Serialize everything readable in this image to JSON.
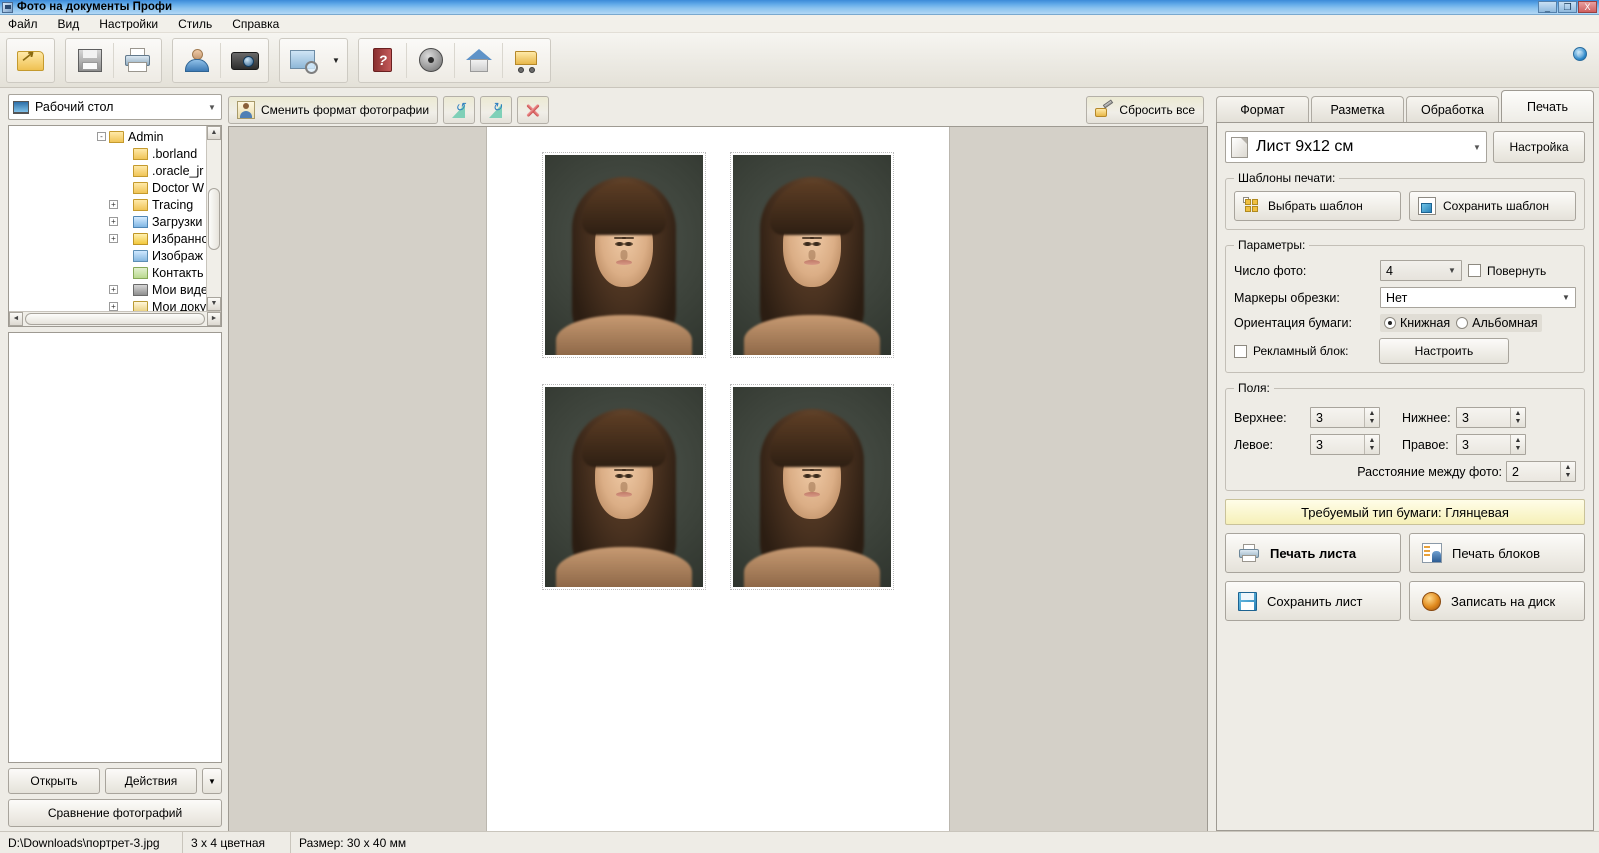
{
  "window": {
    "title": "Фото на документы Профи",
    "icon": "app-icon",
    "buttons": {
      "minimize": "_",
      "maximize": "❐",
      "close": "X"
    }
  },
  "menubar": {
    "items": [
      {
        "label": "Файл"
      },
      {
        "label": "Вид"
      },
      {
        "label": "Настройки"
      },
      {
        "label": "Стиль"
      },
      {
        "label": "Справка"
      }
    ]
  },
  "toolbar": {
    "groups": [
      {
        "buttons": [
          {
            "icon": "open-folder-icon"
          }
        ]
      },
      {
        "buttons": [
          {
            "icon": "save-disk-icon"
          },
          {
            "icon": "printer-icon"
          }
        ]
      },
      {
        "buttons": [
          {
            "icon": "person-photo-icon"
          },
          {
            "icon": "camera-icon"
          }
        ]
      },
      {
        "buttons": [
          {
            "icon": "zoom-preview-icon"
          },
          {
            "icon": "chevron-down-icon"
          }
        ]
      },
      {
        "buttons": [
          {
            "icon": "help-book-icon"
          },
          {
            "icon": "film-reel-icon"
          },
          {
            "icon": "home-icon"
          },
          {
            "icon": "cart-icon"
          }
        ]
      }
    ],
    "help_badge": "info-globe-icon"
  },
  "left_panel": {
    "location_combo": {
      "value": "Рабочий стол",
      "icon": "desktop-monitor-icon",
      "arrow": "▼"
    },
    "tree": [
      {
        "label": "Admin",
        "expander": "-",
        "indent": 0,
        "icon": "folder-icon"
      },
      {
        "label": ".borland",
        "expander": "",
        "indent": 1,
        "icon": "folder-icon"
      },
      {
        "label": ".oracle_jr",
        "expander": "",
        "indent": 1,
        "icon": "folder-icon"
      },
      {
        "label": "Doctor W",
        "expander": "",
        "indent": 1,
        "icon": "folder-icon"
      },
      {
        "label": "Tracing",
        "expander": "+",
        "indent": 1,
        "icon": "folder-icon"
      },
      {
        "label": "Загрузки",
        "expander": "+",
        "indent": 1,
        "icon": "folder-downloads-icon"
      },
      {
        "label": "Избранно",
        "expander": "+",
        "indent": 1,
        "icon": "folder-favorites-icon"
      },
      {
        "label": "Изображ",
        "expander": "",
        "indent": 1,
        "icon": "folder-pictures-icon"
      },
      {
        "label": "Контакть",
        "expander": "",
        "indent": 1,
        "icon": "folder-contacts-icon"
      },
      {
        "label": "Мои виде",
        "expander": "+",
        "indent": 1,
        "icon": "folder-videos-icon"
      },
      {
        "label": "Мои доку",
        "expander": "+",
        "indent": 1,
        "icon": "folder-documents-icon"
      }
    ],
    "scroll": {
      "up": "▲",
      "down": "▼",
      "left": "◄",
      "right": "►"
    },
    "buttons": {
      "open": "Открыть",
      "actions": "Действия",
      "actions_arrow": "▼",
      "compare": "Сравнение фотографий"
    }
  },
  "center": {
    "toolbar": {
      "change_format": {
        "label": "Сменить формат фотографии",
        "icon": "person-card-icon"
      },
      "rotate_left": {
        "icon": "rotate-left-icon"
      },
      "rotate_right": {
        "icon": "rotate-right-icon"
      },
      "delete": {
        "icon": "delete-cross-icon"
      },
      "reset_all": {
        "label": "Сбросить все",
        "icon": "brush-reset-icon"
      }
    },
    "sheet": {
      "photo_count": 4,
      "photo_alt": "portrait-photo"
    }
  },
  "right_panel": {
    "tabs": [
      {
        "label": "Формат",
        "active": false
      },
      {
        "label": "Разметка",
        "active": false
      },
      {
        "label": "Обработка",
        "active": false
      },
      {
        "label": "Печать",
        "active": true
      }
    ],
    "sheet_size": {
      "value": "Лист 9x12 см",
      "icon": "page-icon",
      "arrow": "▼"
    },
    "settings_button": "Настройка",
    "templates": {
      "legend": "Шаблоны печати:",
      "choose": {
        "label": "Выбрать шаблон",
        "icon": "template-grid-icon"
      },
      "save": {
        "label": "Сохранить шаблон",
        "icon": "template-save-icon"
      }
    },
    "parameters": {
      "legend": "Параметры:",
      "photo_count": {
        "label": "Число фото:",
        "value": "4",
        "arrow": "▼"
      },
      "rotate": {
        "label": "Повернуть",
        "checked": false
      },
      "crop_markers": {
        "label": "Маркеры обрезки:",
        "value": "Нет",
        "arrow": "▼"
      },
      "orientation": {
        "label": "Ориентация бумаги:",
        "options": [
          {
            "label": "Книжная",
            "selected": true
          },
          {
            "label": "Альбомная",
            "selected": false
          }
        ]
      },
      "ad_block": {
        "label": "Рекламный блок:",
        "checked": false,
        "button": "Настроить"
      }
    },
    "margins": {
      "legend": "Поля:",
      "top": {
        "label": "Верхнее:",
        "value": "3"
      },
      "bottom": {
        "label": "Нижнее:",
        "value": "3"
      },
      "left": {
        "label": "Левое:",
        "value": "3"
      },
      "right": {
        "label": "Правое:",
        "value": "3"
      },
      "spacing": {
        "label": "Расстояние между фото:",
        "value": "2"
      },
      "spinner": {
        "up": "▲",
        "down": "▼"
      }
    },
    "paper_banner": "Требуемый тип бумаги: Глянцевая",
    "actions": {
      "print_sheet": {
        "label": "Печать листа",
        "icon": "printer-icon"
      },
      "print_blocks": {
        "label": "Печать блоков",
        "icon": "blocks-icon"
      },
      "save_sheet": {
        "label": "Сохранить лист",
        "icon": "floppy-icon"
      },
      "burn_disc": {
        "label": "Записать на диск",
        "icon": "disc-burn-icon"
      }
    }
  },
  "statusbar": {
    "file_path": "D:\\Downloads\\портрет-3.jpg",
    "format": "3 x 4 цветная",
    "size": "Размер: 30 x 40 мм"
  },
  "colors": {
    "title_accent": "#3b8ad8",
    "panel_bg": "#eeece6",
    "canvas_bg": "#d4d0c8",
    "banner_bg": "#f6f0b8"
  }
}
